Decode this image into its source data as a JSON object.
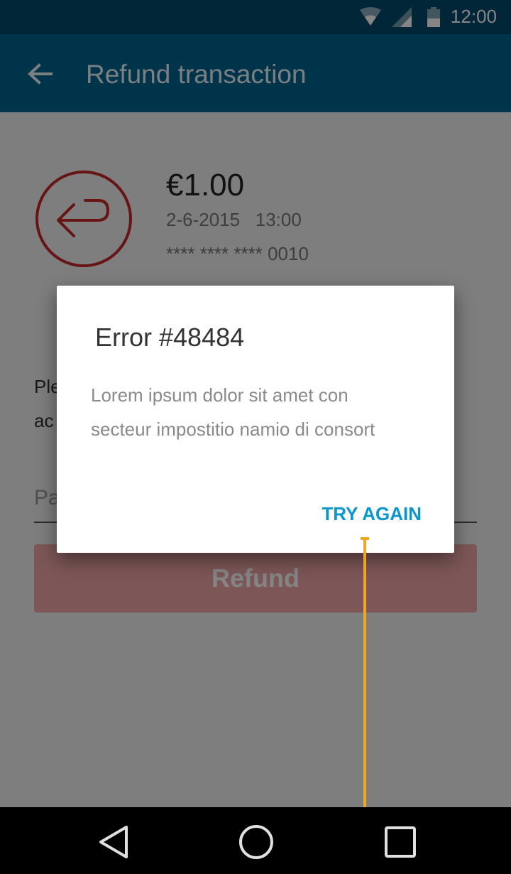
{
  "status_bar": {
    "time": "12:00",
    "icons": [
      "wifi-icon",
      "signal-icon",
      "battery-icon"
    ]
  },
  "app_bar": {
    "title": "Refund transaction",
    "back_icon": "arrow-left-icon"
  },
  "transaction": {
    "amount": "€1.00",
    "date": "2-6-2015",
    "time": "13:00",
    "card_number": "**** **** **** 0010",
    "icon": "refund-arrow-icon"
  },
  "form": {
    "instruction_fragment": "Ple\nac",
    "password_placeholder": "Pa",
    "refund_label": "Refund"
  },
  "dialog": {
    "title": "Error #48484",
    "message": "Lorem ipsum dolor sit amet con\nsecteur impostitio namio di consort",
    "action_label": "TRY AGAIN"
  },
  "nav": {
    "icons": [
      "back-triangle-icon",
      "home-circle-icon",
      "recents-square-icon"
    ]
  },
  "colors": {
    "app_bar": "#00658f",
    "status_bar": "#004a6b",
    "accent": "#0a96cf",
    "refund_red": "#c62828",
    "annotation": "#f0a623"
  }
}
